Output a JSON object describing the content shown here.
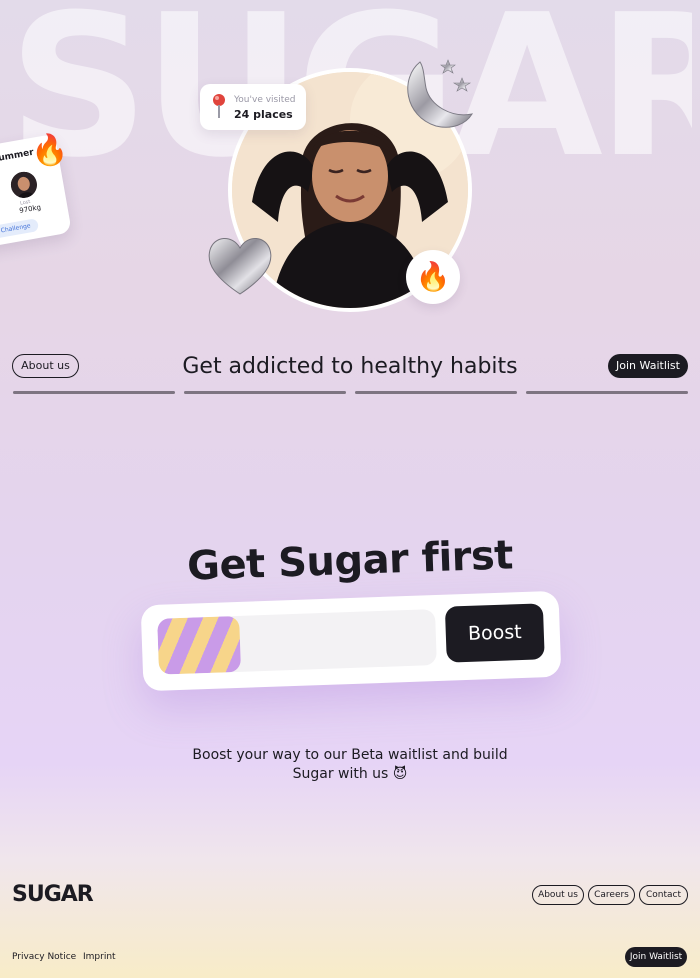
{
  "hero": {
    "bg_wordmark": "SUGAR",
    "visited_card": {
      "label": "You've visited",
      "value": "24 places"
    },
    "challenge_card": {
      "title": "Summer",
      "stat_label": "Lost",
      "stat_value": "970kg",
      "chip_label": "Lost Challenge"
    },
    "fire_emoji": "🔥",
    "moon_icon": "crescent-moon-icon",
    "heart_icon": "chrome-heart-icon"
  },
  "nav": {
    "about_label": "About us",
    "tagline": "Get addicted to healthy habits",
    "join_label": "Join Waitlist",
    "progress": [
      1,
      1,
      1,
      1
    ]
  },
  "cta": {
    "title": "Get Sugar first",
    "input_placeholder": "",
    "button_label": "Boost",
    "description": "Boost your way to our Beta waitlist and build Sugar with us 😈"
  },
  "footer": {
    "logo": "SUGAR",
    "links": [
      "About us",
      "Careers",
      "Contact"
    ],
    "privacy_label": "Privacy Notice",
    "imprint_label": "Imprint",
    "join_label": "Join Waitlist"
  },
  "colors": {
    "ink": "#1c1b22",
    "accent_purple": "#c99be8",
    "accent_yellow": "#f7d58a",
    "link_blue": "#3f6fd8"
  }
}
